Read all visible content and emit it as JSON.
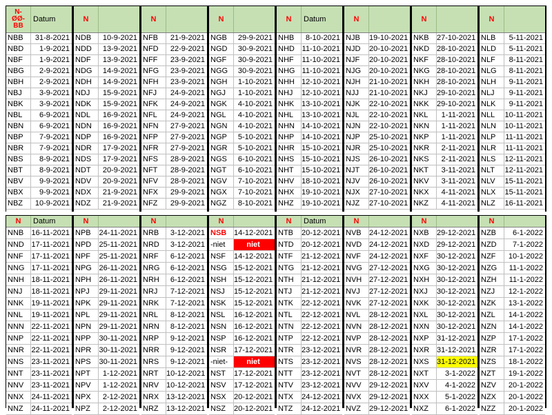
{
  "top": [
    {
      "hcode": "N-\nØØ-\nBB",
      "hdate": "Datum",
      "rows": [
        [
          "NBB",
          "31-8-2021"
        ],
        [
          "NBD",
          "1-9-2021"
        ],
        [
          "NBF",
          "1-9-2021"
        ],
        [
          "NBG",
          "2-9-2021"
        ],
        [
          "NBH",
          "2-9-2021"
        ],
        [
          "NBJ",
          "3-9-2021"
        ],
        [
          "NBK",
          "3-9-2021"
        ],
        [
          "NBL",
          "6-9-2021"
        ],
        [
          "NBN",
          "6-9-2021"
        ],
        [
          "NBP",
          "7-9-2021"
        ],
        [
          "NBR",
          "7-9-2021"
        ],
        [
          "NBS",
          "8-9-2021"
        ],
        [
          "NBT",
          "8-9-2021"
        ],
        [
          "NBV",
          "9-9-2021"
        ],
        [
          "NBX",
          "9-9-2021"
        ],
        [
          "NBZ",
          "10-9-2021"
        ]
      ]
    },
    {
      "hcode": "N",
      "hdate": "",
      "rows": [
        [
          "NDB",
          "10-9-2021"
        ],
        [
          "NDD",
          "13-9-2021"
        ],
        [
          "NDF",
          "13-9-2021"
        ],
        [
          "NDG",
          "14-9-2021"
        ],
        [
          "NDH",
          "14-9-2021"
        ],
        [
          "NDJ",
          "15-9-2021"
        ],
        [
          "NDK",
          "15-9-2021"
        ],
        [
          "NDL",
          "16-9-2021"
        ],
        [
          "NDN",
          "16-9-2021"
        ],
        [
          "NDP",
          "16-9-2021"
        ],
        [
          "NDR",
          "17-9-2021"
        ],
        [
          "NDS",
          "17-9-2021"
        ],
        [
          "NDT",
          "20-9-2021"
        ],
        [
          "NDV",
          "20-9-2021"
        ],
        [
          "NDX",
          "21-9-2021"
        ],
        [
          "NDZ",
          "21-9-2021"
        ]
      ]
    },
    {
      "hcode": "N",
      "hdate": "",
      "rows": [
        [
          "NFB",
          "21-9-2021"
        ],
        [
          "NFD",
          "22-9-2021"
        ],
        [
          "NFF",
          "23-9-2021"
        ],
        [
          "NFG",
          "23-9-2021"
        ],
        [
          "NFH",
          "23-9-2021"
        ],
        [
          "NFJ",
          "24-9-2021"
        ],
        [
          "NFK",
          "24-9-2021"
        ],
        [
          "NFL",
          "24-9-2021"
        ],
        [
          "NFN",
          "27-9-2021"
        ],
        [
          "NFP",
          "27-9-2021"
        ],
        [
          "NFR",
          "27-9-2021"
        ],
        [
          "NFS",
          "28-9-2021"
        ],
        [
          "NFT",
          "28-9-2021"
        ],
        [
          "NFV",
          "28-9-2021"
        ],
        [
          "NFX",
          "29-9-2021"
        ],
        [
          "NFZ",
          "29-9-2021"
        ]
      ]
    },
    {
      "hcode": "N",
      "hdate": "",
      "rows": [
        [
          "NGB",
          "29-9-2021"
        ],
        [
          "NGD",
          "30-9-2021"
        ],
        [
          "NGF",
          "30-9-2021"
        ],
        [
          "NGG",
          "30-9-2021"
        ],
        [
          "NGH",
          "1-10-2021"
        ],
        [
          "NGJ",
          "1-10-2021"
        ],
        [
          "NGK",
          "4-10-2021"
        ],
        [
          "NGL",
          "4-10-2021"
        ],
        [
          "NGN",
          "4-10-2021"
        ],
        [
          "NGP",
          "5-10-2021"
        ],
        [
          "NGR",
          "5-10-2021"
        ],
        [
          "NGS",
          "6-10-2021"
        ],
        [
          "NGT",
          "6-10-2021"
        ],
        [
          "NGV",
          "7-10-2021"
        ],
        [
          "NGX",
          "7-10-2021"
        ],
        [
          "NGZ",
          "8-10-2021"
        ]
      ]
    },
    {
      "hcode": "N",
      "hdate": "Datum",
      "rows": [
        [
          "NHB",
          "8-10-2021"
        ],
        [
          "NHD",
          "11-10-2021"
        ],
        [
          "NHF",
          "11-10-2021"
        ],
        [
          "NHG",
          "11-10-2021"
        ],
        [
          "NHH",
          "12-10-2021"
        ],
        [
          "NHJ",
          "12-10-2021"
        ],
        [
          "NHK",
          "13-10-2021"
        ],
        [
          "NHL",
          "13-10-2021"
        ],
        [
          "NHN",
          "14-10-2021"
        ],
        [
          "NHP",
          "14-10-2021"
        ],
        [
          "NHR",
          "15-10-2021"
        ],
        [
          "NHS",
          "15-10-2021"
        ],
        [
          "NHT",
          "15-10-2021"
        ],
        [
          "NHV",
          "18-10-2021"
        ],
        [
          "NHX",
          "19-10-2021"
        ],
        [
          "NHZ",
          "19-10-2021"
        ]
      ]
    },
    {
      "hcode": "N",
      "hdate": "",
      "rows": [
        [
          "NJB",
          "19-10-2021"
        ],
        [
          "NJD",
          "20-10-2021"
        ],
        [
          "NJF",
          "20-10-2021"
        ],
        [
          "NJG",
          "20-10-2021"
        ],
        [
          "NJH",
          "21-10-2021"
        ],
        [
          "NJJ",
          "21-10-2021"
        ],
        [
          "NJK",
          "22-10-2021"
        ],
        [
          "NJL",
          "22-10-2021"
        ],
        [
          "NJN",
          "22-10-2021"
        ],
        [
          "NJP",
          "25-10-2021"
        ],
        [
          "NJR",
          "25-10-2021"
        ],
        [
          "NJS",
          "26-10-2021"
        ],
        [
          "NJT",
          "26-10-2021"
        ],
        [
          "NJV",
          "26-10-2021"
        ],
        [
          "NJX",
          "27-10-2021"
        ],
        [
          "NJZ",
          "27-10-2021"
        ]
      ]
    },
    {
      "hcode": "N",
      "hdate": "",
      "rows": [
        [
          "NKB",
          "27-10-2021"
        ],
        [
          "NKD",
          "28-10-2021"
        ],
        [
          "NKF",
          "28-10-2021"
        ],
        [
          "NKG",
          "28-10-2021"
        ],
        [
          "NKH",
          "28-10-2021"
        ],
        [
          "NKJ",
          "29-10-2021"
        ],
        [
          "NKK",
          "29-10-2021"
        ],
        [
          "NKL",
          "1-11-2021"
        ],
        [
          "NKN",
          "1-11-2021"
        ],
        [
          "NKP",
          "1-11-2021"
        ],
        [
          "NKR",
          "2-11-2021"
        ],
        [
          "NKS",
          "2-11-2021"
        ],
        [
          "NKT",
          "3-11-2021"
        ],
        [
          "NKV",
          "3-11-2021"
        ],
        [
          "NKX",
          "4-11-2021"
        ],
        [
          "NKZ",
          "4-11-2021"
        ]
      ]
    },
    {
      "hcode": "N",
      "hdate": "",
      "rows": [
        [
          "NLB",
          "5-11-2021"
        ],
        [
          "NLD",
          "5-11-2021"
        ],
        [
          "NLF",
          "8-11-2021"
        ],
        [
          "NLG",
          "8-11-2021"
        ],
        [
          "NLH",
          "9-11-2021"
        ],
        [
          "NLJ",
          "9-11-2021"
        ],
        [
          "NLK",
          "9-11-2021"
        ],
        [
          "NLL",
          "10-11-2021"
        ],
        [
          "NLN",
          "10-11-2021"
        ],
        [
          "NLP",
          "11-11-2021"
        ],
        [
          "NLR",
          "11-11-2021"
        ],
        [
          "NLS",
          "12-11-2021"
        ],
        [
          "NLT",
          "12-11-2021"
        ],
        [
          "NLV",
          "15-11-2021"
        ],
        [
          "NLX",
          "15-11-2021"
        ],
        [
          "NLZ",
          "16-11-2021"
        ]
      ]
    }
  ],
  "bottom": [
    {
      "hcode": "N",
      "hdate": "Datum",
      "rows": [
        [
          "NNB",
          "16-11-2021"
        ],
        [
          "NND",
          "17-11-2021"
        ],
        [
          "NNF",
          "17-11-2021"
        ],
        [
          "NNG",
          "17-11-2021"
        ],
        [
          "NNH",
          "18-11-2021"
        ],
        [
          "NNJ",
          "18-11-2021"
        ],
        [
          "NNK",
          "19-11-2021"
        ],
        [
          "NNL",
          "19-11-2021"
        ],
        [
          "NNN",
          "22-11-2021"
        ],
        [
          "NNP",
          "22-11-2021"
        ],
        [
          "NNR",
          "22-11-2021"
        ],
        [
          "NNS",
          "23-11-2021"
        ],
        [
          "NNT",
          "23-11-2021"
        ],
        [
          "NNV",
          "23-11-2021"
        ],
        [
          "NNX",
          "24-11-2021"
        ],
        [
          "NNZ",
          "24-11-2021"
        ]
      ]
    },
    {
      "hcode": "N",
      "hdate": "",
      "rows": [
        [
          "NPB",
          "24-11-2021"
        ],
        [
          "NPD",
          "25-11-2021"
        ],
        [
          "NPF",
          "25-11-2021"
        ],
        [
          "NPG",
          "26-11-2021"
        ],
        [
          "NPH",
          "26-11-2021"
        ],
        [
          "NPJ",
          "29-11-2021"
        ],
        [
          "NPK",
          "29-11-2021"
        ],
        [
          "NPL",
          "29-11-2021"
        ],
        [
          "NPN",
          "29-11-2021"
        ],
        [
          "NPP",
          "30-11-2021"
        ],
        [
          "NPR",
          "30-11-2021"
        ],
        [
          "NPS",
          "30-11-2021"
        ],
        [
          "NPT",
          "1-12-2021"
        ],
        [
          "NPV",
          "1-12-2021"
        ],
        [
          "NPX",
          "2-12-2021"
        ],
        [
          "NPZ",
          "2-12-2021"
        ]
      ]
    },
    {
      "hcode": "N",
      "hdate": "",
      "rows": [
        [
          "NRB",
          "3-12-2021"
        ],
        [
          "NRD",
          "3-12-2021"
        ],
        [
          "NRF",
          "6-12-2021"
        ],
        [
          "NRG",
          "6-12-2021"
        ],
        [
          "NRH",
          "6-12-2021"
        ],
        [
          "NRJ",
          "7-12-2021"
        ],
        [
          "NRK",
          "7-12-2021"
        ],
        [
          "NRL",
          "8-12-2021"
        ],
        [
          "NRN",
          "8-12-2021"
        ],
        [
          "NRP",
          "9-12-2021"
        ],
        [
          "NRR",
          "9-12-2021"
        ],
        [
          "NRS",
          "9-12-2021"
        ],
        [
          "NRT",
          "10-12-2021"
        ],
        [
          "NRV",
          "10-12-2021"
        ],
        [
          "NRX",
          "13-12-2021"
        ],
        [
          "NRZ",
          "13-12-2021"
        ]
      ]
    },
    {
      "hcode": "N",
      "hdate": "",
      "rows": [
        [
          "NSB",
          "14-12-2021",
          "hl"
        ],
        [
          "-niet",
          "niet",
          "red"
        ],
        [
          "NSF",
          "14-12-2021"
        ],
        [
          "NSG",
          "15-12-2021"
        ],
        [
          "NSH",
          "15-12-2021"
        ],
        [
          "NSJ",
          "15-12-2021"
        ],
        [
          "NSK",
          "15-12-2021"
        ],
        [
          "NSL",
          "16-12-2021"
        ],
        [
          "NSN",
          "16-12-2021"
        ],
        [
          "NSP",
          "16-12-2021"
        ],
        [
          "NSR",
          "17-12-2021"
        ],
        [
          "-niet-",
          "niet",
          "red"
        ],
        [
          "NST",
          "17-12-2021"
        ],
        [
          "NSV",
          "17-12-2021"
        ],
        [
          "NSX",
          "20-12-2021"
        ],
        [
          "NSZ",
          "20-12-2021"
        ]
      ]
    },
    {
      "hcode": "N",
      "hdate": "Datum",
      "rows": [
        [
          "NTB",
          "20-12-2021"
        ],
        [
          "NTD",
          "20-12-2021"
        ],
        [
          "NTF",
          "21-12-2021"
        ],
        [
          "NTG",
          "21-12-2021"
        ],
        [
          "NTH",
          "21-12-2021"
        ],
        [
          "NTJ",
          "21-12-2021"
        ],
        [
          "NTK",
          "22-12-2021"
        ],
        [
          "NTL",
          "22-12-2021"
        ],
        [
          "NTN",
          "22-12-2021"
        ],
        [
          "NTP",
          "22-12-2021"
        ],
        [
          "NTR",
          "23-12-2021"
        ],
        [
          "NTS",
          "23-12-2021"
        ],
        [
          "NTT",
          "23-12-2021"
        ],
        [
          "NTV",
          "23-12-2021"
        ],
        [
          "NTX",
          "24-12-2021"
        ],
        [
          "NTZ",
          "24-12-2021"
        ]
      ]
    },
    {
      "hcode": "N",
      "hdate": "",
      "rows": [
        [
          "NVB",
          "24-12-2021"
        ],
        [
          "NVD",
          "24-12-2021"
        ],
        [
          "NVF",
          "24-12-2021"
        ],
        [
          "NVG",
          "27-12-2021"
        ],
        [
          "NVH",
          "27-12-2021"
        ],
        [
          "NVJ",
          "27-12-2021"
        ],
        [
          "NVK",
          "27-12-2021"
        ],
        [
          "NVL",
          "28-12-2021"
        ],
        [
          "NVN",
          "28-12-2021"
        ],
        [
          "NVP",
          "28-12-2021"
        ],
        [
          "NVR",
          "28-12-2021"
        ],
        [
          "NVS",
          "28-12-2021"
        ],
        [
          "NVT",
          "28-12-2021"
        ],
        [
          "NVV",
          "29-12-2021"
        ],
        [
          "NVX",
          "29-12-2021"
        ],
        [
          "NVZ",
          "29-12-2021"
        ]
      ]
    },
    {
      "hcode": "N",
      "hdate": "",
      "rows": [
        [
          "NXB",
          "29-12-2021"
        ],
        [
          "NXD",
          "29-12-2021"
        ],
        [
          "NXF",
          "30-12-2021"
        ],
        [
          "NXG",
          "30-12-2021"
        ],
        [
          "NXH",
          "30-12-2021"
        ],
        [
          "NXJ",
          "30-12-2021"
        ],
        [
          "NXK",
          "30-12-2021"
        ],
        [
          "NXL",
          "30-12-2021"
        ],
        [
          "NXN",
          "30-12-2021"
        ],
        [
          "NXP",
          "31-12-2021"
        ],
        [
          "NXR",
          "31-12-2021"
        ],
        [
          "NXS",
          "31-12-2021",
          "yel"
        ],
        [
          "NXT",
          "3-1-2022"
        ],
        [
          "NXV",
          "4-1-2022"
        ],
        [
          "NXX",
          "5-1-2022"
        ],
        [
          "NXZ",
          "6-1-2022"
        ]
      ]
    },
    {
      "hcode": "N",
      "hdate": "",
      "rows": [
        [
          "NZB",
          "6-1-2022"
        ],
        [
          "NZD",
          "7-1-2022"
        ],
        [
          "NZF",
          "10-1-2022"
        ],
        [
          "NZG",
          "11-1-2022"
        ],
        [
          "NZH",
          "11-1-2022"
        ],
        [
          "NZJ",
          "12-1-2022"
        ],
        [
          "NZK",
          "13-1-2022"
        ],
        [
          "NZL",
          "14-1-2022"
        ],
        [
          "NZN",
          "14-1-2022"
        ],
        [
          "NZP",
          "17-1-2022"
        ],
        [
          "NZR",
          "17-1-2022"
        ],
        [
          "NZS",
          "18-1-2022"
        ],
        [
          "NZT",
          "19-1-2022"
        ],
        [
          "NZV",
          "20-1-2022"
        ],
        [
          "NZX",
          "20-1-2022"
        ],
        [
          "NZZ",
          "20-1-2022"
        ]
      ]
    }
  ],
  "colors": {
    "header_bg": "#c6e0b4",
    "accent_red": "#ff0000",
    "highlight_yellow": "#ffff00"
  }
}
